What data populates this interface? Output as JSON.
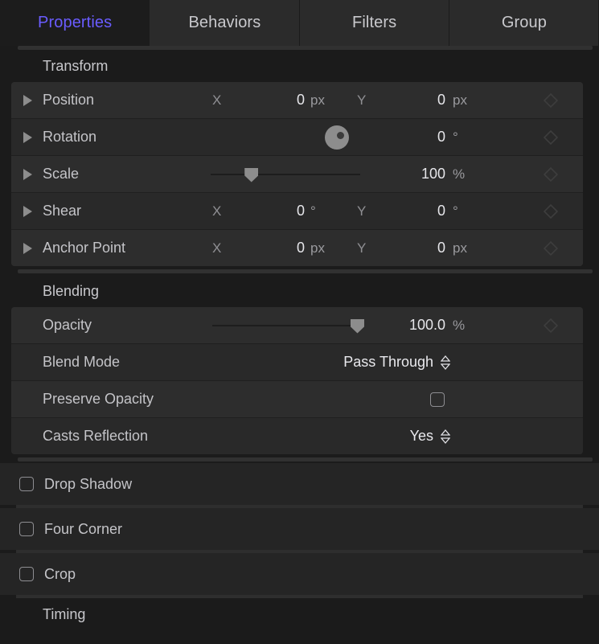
{
  "tabs": [
    {
      "label": "Properties",
      "active": true
    },
    {
      "label": "Behaviors",
      "active": false
    },
    {
      "label": "Filters",
      "active": false
    },
    {
      "label": "Group",
      "active": false
    }
  ],
  "accent_color": "#6a5cff",
  "sections": {
    "transform": {
      "title": "Transform",
      "rows": {
        "position": {
          "label": "Position",
          "x_axis": "X",
          "x_value": "0",
          "x_unit": "px",
          "y_axis": "Y",
          "y_value": "0",
          "y_unit": "px"
        },
        "rotation": {
          "label": "Rotation",
          "value": "0",
          "unit": "°"
        },
        "scale": {
          "label": "Scale",
          "value": "100",
          "unit": "%"
        },
        "shear": {
          "label": "Shear",
          "x_axis": "X",
          "x_value": "0",
          "x_unit": "°",
          "y_axis": "Y",
          "y_value": "0",
          "y_unit": "°"
        },
        "anchor": {
          "label": "Anchor Point",
          "x_axis": "X",
          "x_value": "0",
          "x_unit": "px",
          "y_axis": "Y",
          "y_value": "0",
          "y_unit": "px"
        }
      }
    },
    "blending": {
      "title": "Blending",
      "rows": {
        "opacity": {
          "label": "Opacity",
          "value": "100.0",
          "unit": "%"
        },
        "blend_mode": {
          "label": "Blend Mode",
          "value": "Pass Through"
        },
        "preserve_opacity": {
          "label": "Preserve Opacity",
          "checked": false
        },
        "casts_reflection": {
          "label": "Casts Reflection",
          "value": "Yes"
        }
      }
    },
    "timing": {
      "title": "Timing"
    }
  },
  "filters": [
    {
      "label": "Drop Shadow",
      "checked": false
    },
    {
      "label": "Four Corner",
      "checked": false
    },
    {
      "label": "Crop",
      "checked": false
    }
  ]
}
